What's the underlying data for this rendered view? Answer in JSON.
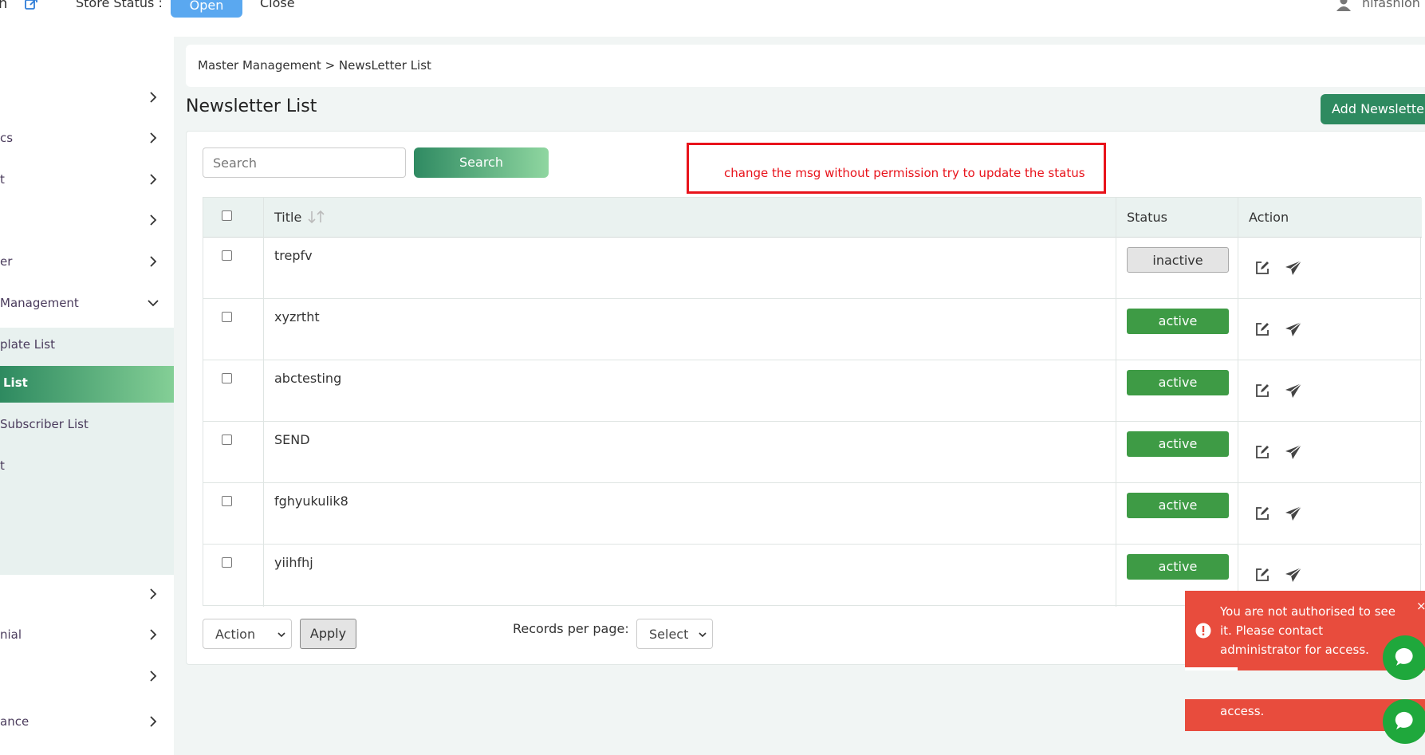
{
  "topbar": {
    "partial_left_char": "n",
    "store_status_label": "Store Status :",
    "open_label": "Open",
    "close_label": "Close",
    "user_name": "hifashion"
  },
  "sidebar": {
    "items": [
      {
        "label": ""
      },
      {
        "label": "cs"
      },
      {
        "label": "t"
      },
      {
        "label": ""
      },
      {
        "label": "er"
      },
      {
        "label": "Management"
      }
    ],
    "sub_items": [
      {
        "label": "plate List"
      },
      {
        "label": "List"
      },
      {
        "label": "Subscriber List"
      },
      {
        "label": "t"
      }
    ],
    "bottom_items": [
      {
        "label": ""
      },
      {
        "label": "nial"
      },
      {
        "label": ""
      },
      {
        "label": "ance"
      }
    ]
  },
  "breadcrumb": "Master Management > NewsLetter List",
  "page_title": "Newsletter List",
  "add_button_label": "Add Newsletter",
  "search": {
    "placeholder": "Search",
    "button_label": "Search"
  },
  "annotation_note": "change the msg without permission try to update the status",
  "table": {
    "columns": {
      "title": "Title",
      "status": "Status",
      "action": "Action"
    },
    "rows": [
      {
        "title": "trepfv",
        "status": "inactive"
      },
      {
        "title": "xyzrtht",
        "status": "active"
      },
      {
        "title": "abctesting",
        "status": "active"
      },
      {
        "title": "SEND",
        "status": "active"
      },
      {
        "title": "fghyukulik8",
        "status": "active"
      },
      {
        "title": "yiihfhj",
        "status": "active"
      }
    ]
  },
  "footer": {
    "action_select": "Action",
    "apply_label": "Apply",
    "records_per_page_label": "Records per page:",
    "records_select": "Select"
  },
  "toasts": {
    "primary_message": "You are not authorised to see it. Please contact administrator for access.",
    "close_symbol": "×",
    "secondary_message": "access."
  },
  "colors": {
    "brand_green": "#2e8a60",
    "active_status": "#3e9b45",
    "toast_red": "#e84c3d",
    "annotation_red": "#e8131b"
  }
}
